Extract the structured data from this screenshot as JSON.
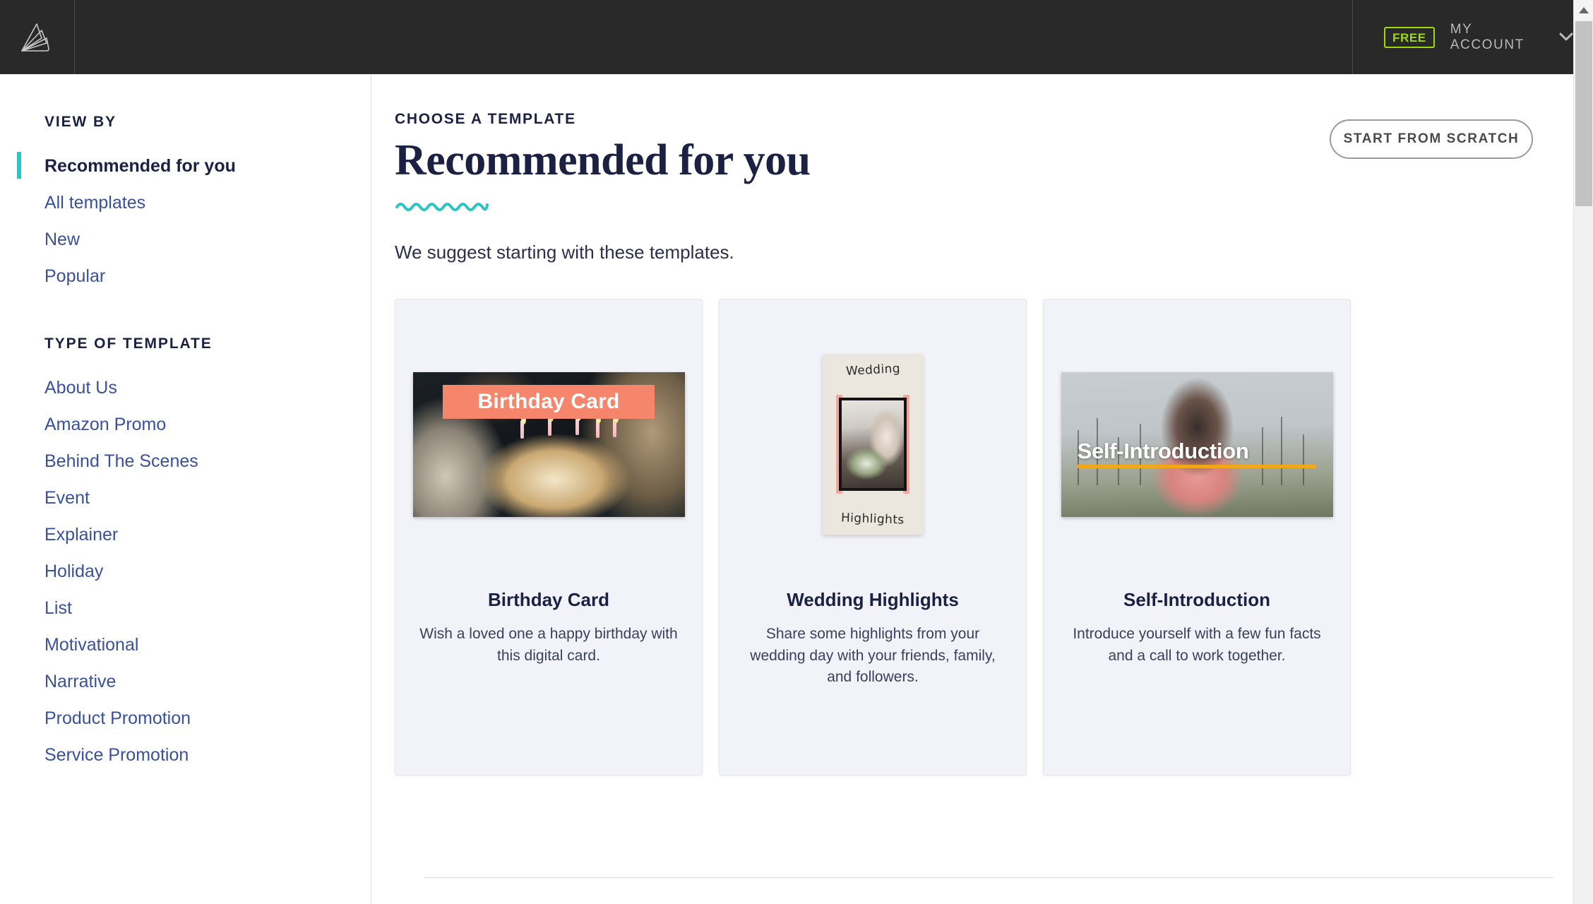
{
  "topbar": {
    "logo_name": "paper-fan-logo",
    "plan_badge": "FREE",
    "account_label": "MY ACCOUNT",
    "chevron_icon": "chevron-down-icon"
  },
  "sidebar": {
    "view_by_title": "VIEW BY",
    "view_by_items": [
      {
        "label": "Recommended for you",
        "active": true
      },
      {
        "label": "All templates",
        "active": false
      },
      {
        "label": "New",
        "active": false
      },
      {
        "label": "Popular",
        "active": false
      }
    ],
    "type_title": "TYPE OF TEMPLATE",
    "type_items": [
      {
        "label": "About Us"
      },
      {
        "label": "Amazon Promo"
      },
      {
        "label": "Behind The Scenes"
      },
      {
        "label": "Event"
      },
      {
        "label": "Explainer"
      },
      {
        "label": "Holiday"
      },
      {
        "label": "List"
      },
      {
        "label": "Motivational"
      },
      {
        "label": "Narrative"
      },
      {
        "label": "Product Promotion"
      },
      {
        "label": "Service Promotion"
      }
    ]
  },
  "main": {
    "eyebrow": "CHOOSE A TEMPLATE",
    "title": "Recommended for you",
    "subtitle": "We suggest starting with these templates.",
    "start_from_scratch_label": "START FROM SCRATCH",
    "accent_color": "#2ec4c4",
    "navy_color": "#1b2142",
    "link_color": "#3a5197"
  },
  "cards": [
    {
      "title": "Birthday Card",
      "description": "Wish a loved one a happy birthday with this digital card.",
      "thumb_overlay_text": "Birthday Card",
      "thumb_accent": "#f5866c",
      "thumb_kind": "landscape-birthday"
    },
    {
      "title": "Wedding Highlights",
      "description": "Share some highlights from your wedding day with your friends, family, and followers.",
      "thumb_top_text": "Wedding",
      "thumb_bottom_text": "Highlights",
      "thumb_accent": "#f0a7a0",
      "thumb_kind": "portrait-wedding"
    },
    {
      "title": "Self-Introduction",
      "description": "Introduce yourself with a few fun facts and a call to work together.",
      "thumb_overlay_text": "Self-Introduction",
      "thumb_accent": "#f0a81a",
      "thumb_kind": "landscape-selfintro"
    }
  ],
  "scrollbar": {
    "up_arrow_icon": "scroll-up-arrow-icon"
  }
}
